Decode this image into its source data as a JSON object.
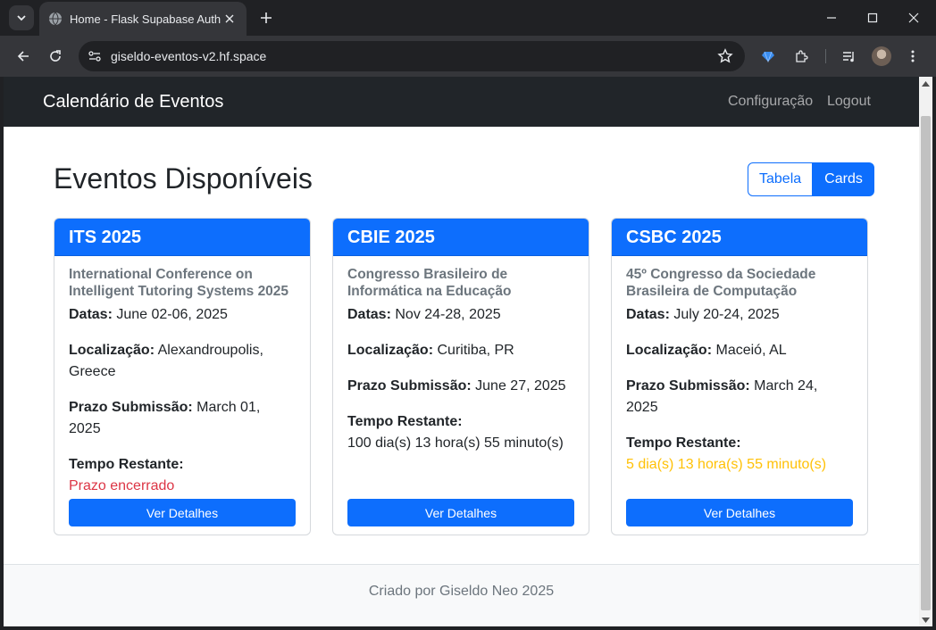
{
  "browser": {
    "tab_title": "Home - Flask Supabase Auth",
    "url": "giseldo-eventos-v2.hf.space"
  },
  "navbar": {
    "brand": "Calendário de Eventos",
    "links": [
      "Configuração",
      "Logout"
    ]
  },
  "page": {
    "title": "Eventos Disponíveis",
    "view_toggle": {
      "table_label": "Tabela",
      "cards_label": "Cards",
      "active": "Cards"
    }
  },
  "labels": {
    "dates": "Datas:",
    "location": "Localização:",
    "deadline": "Prazo Submissão:",
    "remaining": "Tempo Restante:",
    "details_button": "Ver Detalhes"
  },
  "events": [
    {
      "acronym": "ITS 2025",
      "name": "International Conference on Intelligent Tutoring Systems 2025",
      "dates": "June 02-06, 2025",
      "location": "Alexandroupolis, Greece",
      "deadline": "March 01, 2025",
      "remaining": "Prazo encerrado",
      "remaining_status": "expired"
    },
    {
      "acronym": "CBIE 2025",
      "name": "Congresso Brasileiro de Informática na Educação",
      "dates": "Nov 24-28, 2025",
      "location": "Curitiba, PR",
      "deadline": "June 27, 2025",
      "remaining": "100 dia(s) 13 hora(s) 55 minuto(s)",
      "remaining_status": "normal"
    },
    {
      "acronym": "CSBC 2025",
      "name": "45º Congresso da Sociedade Brasileira de Computação",
      "dates": "July 20-24, 2025",
      "location": "Maceió, AL",
      "deadline": "March 24, 2025",
      "remaining": "5 dia(s) 13 hora(s) 55 minuto(s)",
      "remaining_status": "warning"
    }
  ],
  "footer": {
    "text": "Criado por Giseldo Neo 2025"
  },
  "colors": {
    "primary": "#0d6efd",
    "navbar": "#212529",
    "expired": "#dc3545",
    "warning": "#ffc107"
  }
}
